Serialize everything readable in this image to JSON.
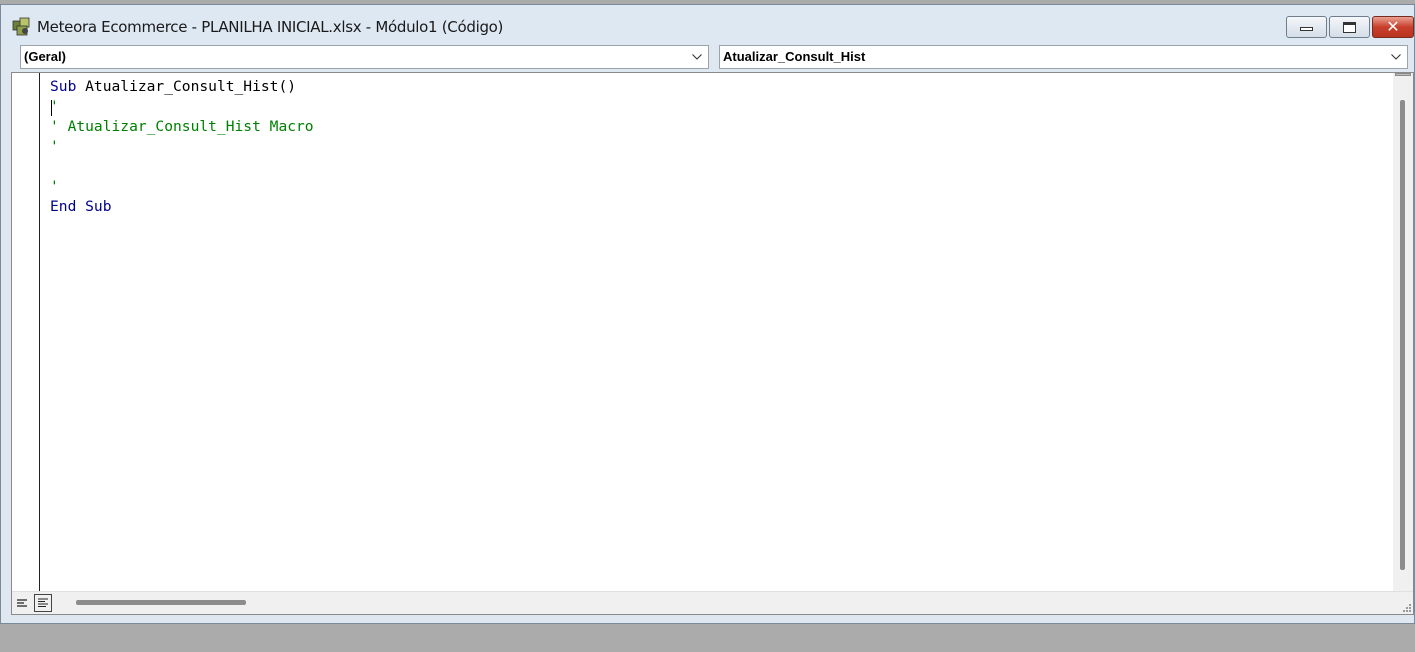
{
  "window": {
    "title": "Meteora Ecommerce - PLANILHA INICIAL.xlsx - Módulo1 (Código)",
    "icon": "vba-module-icon"
  },
  "controls": {
    "minimize": "minimize-icon",
    "maximize": "maximize-icon",
    "close_glyph": "✕"
  },
  "object_combo": {
    "value": "(Geral)"
  },
  "procedure_combo": {
    "value": "Atualizar_Consult_Hist"
  },
  "code": {
    "line1_kw": "Sub",
    "line1_name": " Atualizar_Consult_Hist()",
    "line2": "'",
    "line3": "' Atualizar_Consult_Hist Macro",
    "line4": "'",
    "line5": "",
    "line6": "'",
    "line7_kw": "End Sub"
  },
  "colors": {
    "keyword": "#00008b",
    "comment": "#008000",
    "close_button": "#c8402d"
  }
}
